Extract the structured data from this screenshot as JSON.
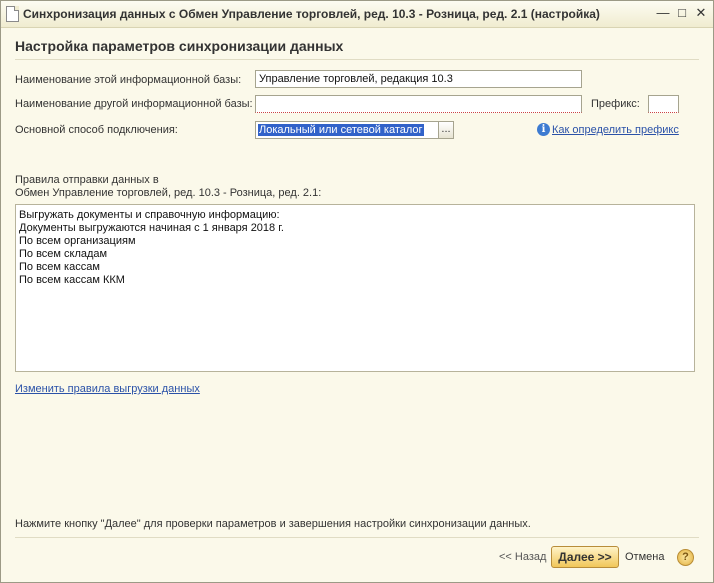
{
  "window": {
    "title": "Синхронизация данных с Обмен Управление торговлей, ред. 10.3 - Розница, ред. 2.1 (настройка)",
    "minimize_glyph": "—",
    "maximize_glyph": "□",
    "close_glyph": "✕"
  },
  "heading": "Настройка параметров синхронизации данных",
  "form": {
    "this_base_label": "Наименование этой информационной базы:",
    "this_base_value": "Управление торговлей, редакция 10.3",
    "other_base_label": "Наименование другой информационной базы:",
    "other_base_value": "",
    "prefix_label": "Префикс:",
    "prefix_value": "",
    "connection_label": "Основной способ подключения:",
    "connection_value": "Локальный или сетевой каталог",
    "select_button_label": "...",
    "prefix_help_link": "Как определить префикс"
  },
  "rules": {
    "caption_line1": "Правила отправки данных в",
    "caption_line2": "Обмен Управление торговлей, ред. 10.3 - Розница, ред. 2.1:",
    "lines": [
      "Выгружать документы и справочную информацию:",
      "Документы выгружаются начиная с 1 января 2018 г.",
      "По всем организациям",
      "По всем складам",
      "По всем кассам",
      "По всем кассам ККМ"
    ],
    "change_link": "Изменить правила выгрузки данных"
  },
  "footer": {
    "hint": "Нажмите кнопку \"Далее\" для проверки параметров и завершения настройки синхронизации данных.",
    "back_label": "<< Назад",
    "next_label": "Далее >>",
    "cancel_label": "Отмена",
    "help_glyph": "?"
  }
}
